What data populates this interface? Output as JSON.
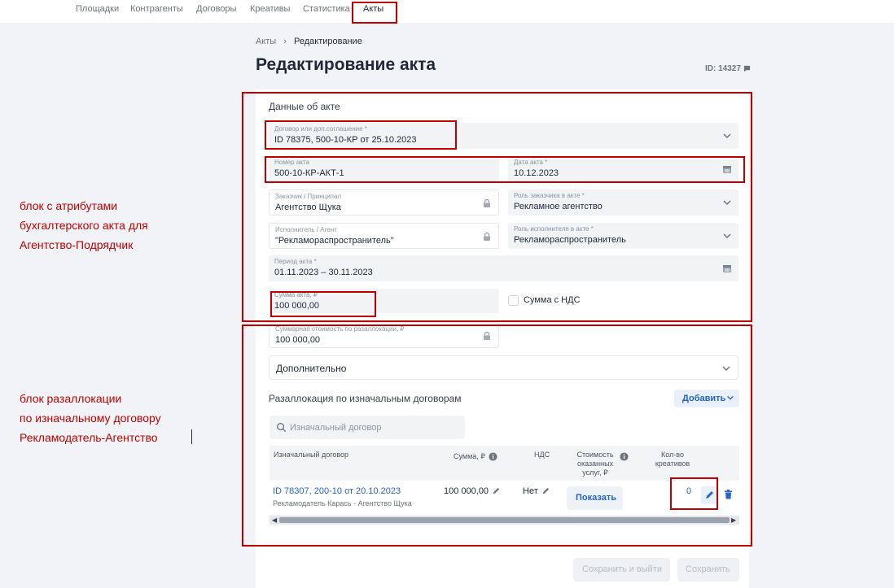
{
  "nav": {
    "items": [
      "Площадки",
      "Контрагенты",
      "Договоры",
      "Креативы",
      "Статистика",
      "Акты"
    ]
  },
  "annotations": {
    "block1": [
      "блок с атрибутами",
      "бухгалтерского акта для",
      "Агентство-Подрядчик"
    ],
    "block2": [
      "блок разаллокации",
      "по изначальному договору",
      "Рекламодатель-Агентство"
    ]
  },
  "breadcrumb": {
    "root": "Акты",
    "current": "Редактирование"
  },
  "page": {
    "title": "Редактирование акта",
    "record_id": "ID: 14327"
  },
  "act": {
    "section_title": "Данные об акте",
    "contract": {
      "label": "Договор или доп.соглашение *",
      "value": "ID 78375, 500-10-КР от 25.10.2023"
    },
    "number": {
      "label": "Номер акта",
      "value": "500-10-КР-АКТ-1"
    },
    "date": {
      "label": "Дата акта *",
      "value": "10.12.2023"
    },
    "customer": {
      "label": "Заказчик / Принципал",
      "value": "Агентство Щука"
    },
    "customer_role": {
      "label": "Роль заказчика в акте *",
      "value": "Рекламное агентство"
    },
    "executor": {
      "label": "Исполнитель / Агент",
      "value": "\"Рекламораспространитель\""
    },
    "executor_role": {
      "label": "Роль исполнителя в акте *",
      "value": "Рекламораспространитель"
    },
    "period": {
      "label": "Период акта *",
      "value": "01.11.2023 – 30.11.2023"
    },
    "amount": {
      "label": "Сумма акта, ₽",
      "value": "100 000,00"
    },
    "vat_label": "Сумма с НДС",
    "realloc_total": {
      "label": "Суммарная стоимость по разаллокации, ₽",
      "value": "100 000,00"
    }
  },
  "additional": {
    "label": "Дополнительно"
  },
  "realloc": {
    "title": "Разаллокация по изначальным договорам",
    "add_label": "Добавить",
    "search_placeholder": "Изначальный договор",
    "columns": {
      "contract": "Изначальный договор",
      "sum": "Сумма, ₽",
      "vat": "НДС",
      "cost": "Стоимость оказанных услуг, ₽",
      "creatives": "Кол-во креативов"
    },
    "row": {
      "contract_link": "ID 78307, 200-10 от 20.10.2023",
      "parties": "Рекламодатель Карась - Агентство Щука",
      "sum": "100 000,00",
      "vat": "Нет",
      "show_label": "Показать",
      "creatives": "0"
    }
  },
  "footer": {
    "save_exit": "Сохранить и выйти",
    "save": "Сохранить"
  },
  "colors": {
    "accent": "#2563c9",
    "annotation": "#c00000"
  }
}
